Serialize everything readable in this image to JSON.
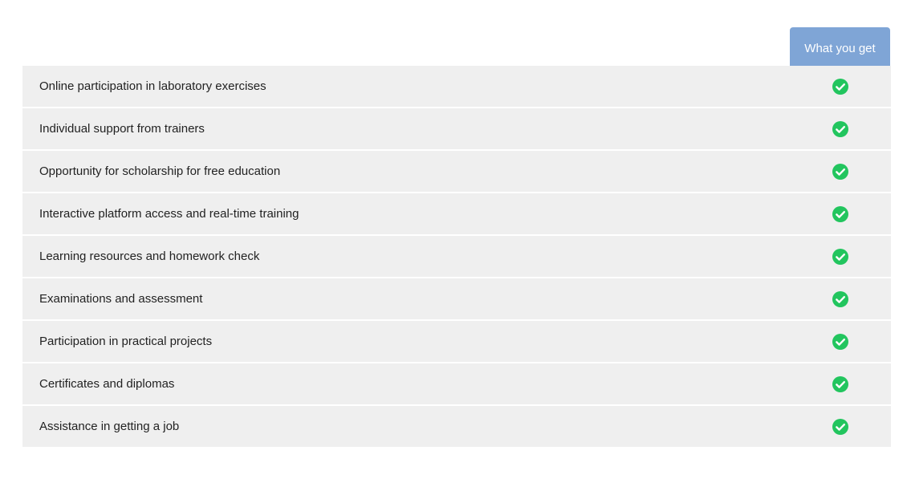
{
  "header": {
    "column_label": "What you get"
  },
  "colors": {
    "header_bg": "#7fa5d6",
    "row_bg": "#efefef",
    "check_green": "#22c55e"
  },
  "rows": [
    {
      "label": "Online participation in laboratory exercises",
      "icon": "check-circle-icon",
      "included": true
    },
    {
      "label": "Individual support from trainers",
      "icon": "check-circle-icon",
      "included": true
    },
    {
      "label": "Opportunity for scholarship for free education",
      "icon": "check-circle-icon",
      "included": true
    },
    {
      "label": "Interactive platform access and real-time training",
      "icon": "check-circle-icon",
      "included": true
    },
    {
      "label": "Learning resources and homework check",
      "icon": "check-circle-icon",
      "included": true
    },
    {
      "label": "Examinations and assessment",
      "icon": "check-circle-icon",
      "included": true
    },
    {
      "label": "Participation in practical projects",
      "icon": "check-circle-icon",
      "included": true
    },
    {
      "label": "Certificates and diplomas",
      "icon": "check-circle-icon",
      "included": true
    },
    {
      "label": "Assistance in getting a job",
      "icon": "check-circle-icon",
      "included": true
    }
  ]
}
